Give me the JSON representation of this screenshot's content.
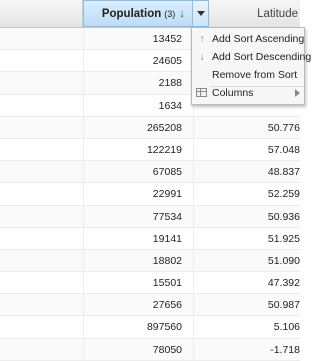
{
  "header": {
    "population_label": "Population",
    "population_sort_count": "(3)",
    "population_sort_arrow": "↓",
    "latitude_label": "Latitude"
  },
  "rows": [
    {
      "population": "13452",
      "latitude": ""
    },
    {
      "population": "24605",
      "latitude": ""
    },
    {
      "population": "2188",
      "latitude": ""
    },
    {
      "population": "1634",
      "latitude": ""
    },
    {
      "population": "265208",
      "latitude": "50.776"
    },
    {
      "population": "122219",
      "latitude": "57.048"
    },
    {
      "population": "67085",
      "latitude": "48.837"
    },
    {
      "population": "22991",
      "latitude": "52.259"
    },
    {
      "population": "77534",
      "latitude": "50.936"
    },
    {
      "population": "19141",
      "latitude": "51.925"
    },
    {
      "population": "18802",
      "latitude": "51.090"
    },
    {
      "population": "15501",
      "latitude": "47.392"
    },
    {
      "population": "27656",
      "latitude": "50.987"
    },
    {
      "population": "897560",
      "latitude": "5.106"
    },
    {
      "population": "78050",
      "latitude": "-1.718"
    }
  ],
  "menu": {
    "sort_ascending": "Add Sort Ascending",
    "sort_descending": "Add Sort Descending",
    "remove_sort": "Remove from Sort",
    "columns": "Columns"
  }
}
